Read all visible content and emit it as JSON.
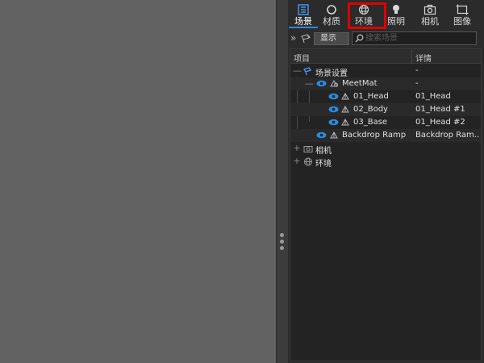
{
  "tabs": [
    {
      "label": "场景",
      "icon": "scene-icon",
      "active": true
    },
    {
      "label": "材质",
      "icon": "material-icon",
      "active": false
    },
    {
      "label": "环境",
      "icon": "environment-icon",
      "active": false
    },
    {
      "label": "照明",
      "icon": "lighting-icon",
      "active": false
    },
    {
      "label": "相机",
      "icon": "camera-icon",
      "active": false
    },
    {
      "label": "图像",
      "icon": "image-icon",
      "active": false
    }
  ],
  "filter": {
    "expand_symbol": "»",
    "show_label": "显示",
    "search_placeholder": "搜索场景"
  },
  "tree": {
    "header_item": "项目",
    "header_detail": "详情",
    "rows": [
      {
        "toggle": "—",
        "name": "场景设置",
        "detail": "-"
      },
      {
        "toggle": "—",
        "name": "MeetMat",
        "detail": "-"
      },
      {
        "name": "01_Head",
        "detail": "01_Head"
      },
      {
        "name": "02_Body",
        "detail": "01_Head #1"
      },
      {
        "name": "03_Base",
        "detail": "01_Head #2"
      },
      {
        "name": "Backdrop Ramp",
        "detail": "Backdrop Ram..."
      },
      {
        "toggle": "+",
        "name": "相机",
        "detail": ""
      },
      {
        "toggle": "+",
        "name": "环境",
        "detail": ""
      }
    ]
  },
  "colors": {
    "accent": "#2f8ad8",
    "eye": "#2f8ad8",
    "highlight": "#e00000",
    "panel_bg": "#2b2b2b",
    "viewport_bg": "#626262"
  }
}
